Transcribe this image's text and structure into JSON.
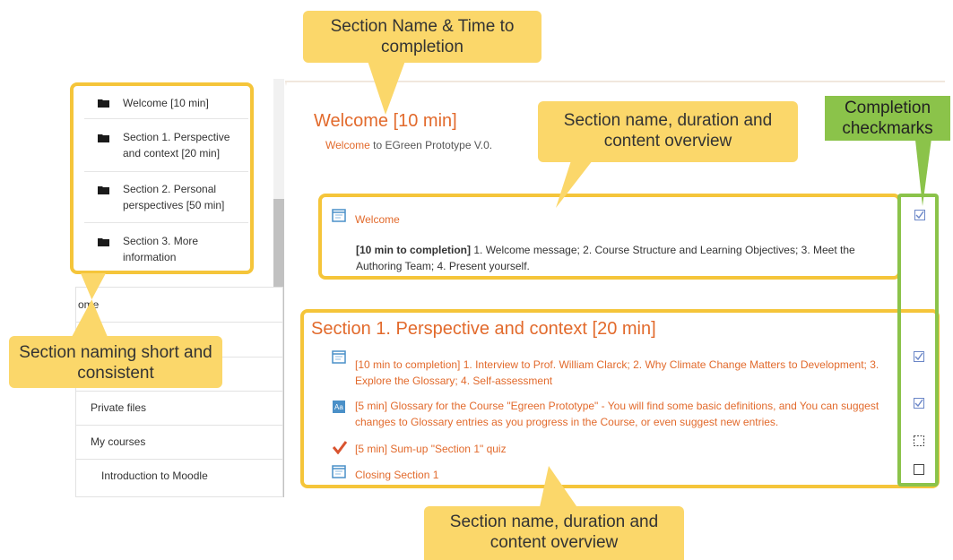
{
  "sidebar": {
    "sections": [
      {
        "label": "Welcome [10 min]"
      },
      {
        "label": "Section 1. Perspective and context [20 min]"
      },
      {
        "label": "Section 2. Personal perspectives [50 min]"
      },
      {
        "label": "Section 3. More information"
      }
    ],
    "nav": [
      {
        "label": "ome"
      },
      {
        "label": "Private files"
      },
      {
        "label": "My courses"
      },
      {
        "label": "Introduction to Moodle"
      }
    ]
  },
  "main": {
    "welcome_title": "Welcome [10 min]",
    "welcome_subtitle_link": "Welcome",
    "welcome_subtitle_rest": " to EGreen Prototype V.0.",
    "welcome_activity": {
      "link": "Welcome",
      "desc_bold": "[10 min to completion]",
      "desc": " 1. Welcome message; 2. Course Structure and Learning Objectives; 3. Meet the Authoring Team; 4. Present yourself."
    },
    "section1_title": "Section 1. Perspective and context [20 min]",
    "section1_activities": [
      {
        "text": "[10 min to completion] 1. Interview to Prof. William Clarck; 2. Why Climate Change Matters to Development; 3. Explore the Glossary; 4. Self-assessment"
      },
      {
        "text": "[5 min] Glossary for the Course \"Egreen Prototype\" - You will find some basic definitions, and You can suggest changes to Glossary entries as you progress in the Course, or even suggest new entries."
      },
      {
        "text": "[5 min] Sum-up \"Section 1\" quiz"
      },
      {
        "text": "Closing Section 1"
      }
    ]
  },
  "callouts": {
    "top": "Section Name & Time to completion",
    "overview_top": "Section name, duration and content overview",
    "checkmarks": "Completion checkmarks",
    "naming": "Section naming short and consistent",
    "overview_bottom": "Section name, duration and content overview"
  },
  "colors": {
    "accent": "#e26a2c",
    "highlight": "#f5c53a",
    "callout": "#fbd76a",
    "green": "#8bc34a"
  }
}
